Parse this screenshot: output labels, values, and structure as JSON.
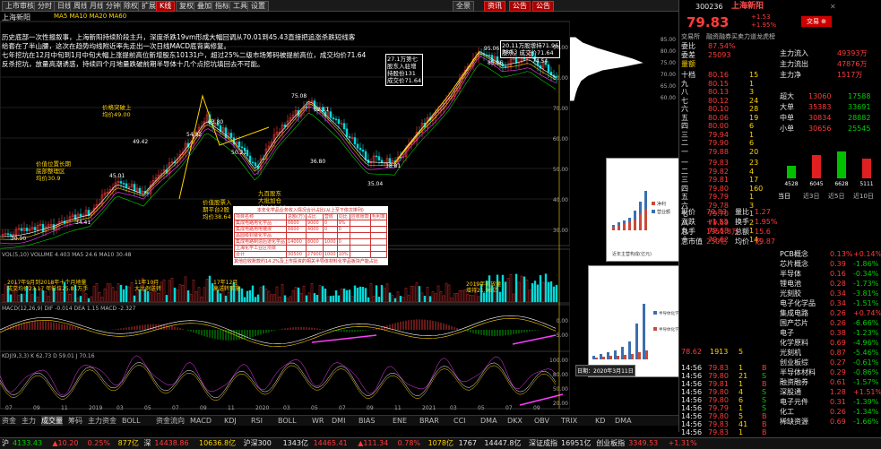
{
  "toolbar": {
    "buttons": [
      "上市审核",
      "分时",
      "日线",
      "周线",
      "月线",
      "分钟",
      "除权",
      "扩展",
      "K线",
      "复权",
      "叠加",
      "指标",
      "工具",
      "设置"
    ],
    "right_buttons": [
      "全景",
      "资讯",
      "公告",
      "公告"
    ]
  },
  "chart": {
    "title": "上海新阳",
    "indicator_bar": "MA5 MA10 MA20 MA60",
    "commentary": [
      "历史底部一次性报叙事，上海新阳持续阶段主升，深度杀跌19vm形成大幅回调从70.01到45.43直接把追涨杀跌短线客",
      "给套在了半山腰，这次在趋势均线附近率先走出一次日线MACD底背离修复。",
      "七年挖坑在12月中旬到1月中旬大幅上涨提前高位新增股东10131户，超过25%二级市场筹码被提前高位，成交均价71.64",
      "反杀挖坑，放量高潮诱惑，持续四个月地量跌破前期半导体十几个点挖坑填回去不可能。"
    ],
    "annotations": [
      {
        "text": "27.1万第七\n股东入驻增\n持股份131\n成交价71.64"
      },
      {
        "text": "20.11万股增持71.96\n股东，成交价71.64"
      },
      {
        "text": "价值位置长期\n底部整理区\n均价30.9"
      },
      {
        "text": "价格突破上\n均价49.00"
      },
      {
        "text": "价值股票入\n期平台2股\n均价38.64"
      },
      {
        "text": "九百股东\n大批加仓\n均价38.18"
      }
    ],
    "price_labels": [
      "95.06",
      "85.86",
      "78.53",
      "74.54",
      "75.08",
      "63.80",
      "62.11",
      "54.92",
      "50.21",
      "49.42",
      "45.01",
      "38.81",
      "36.80",
      "35.04",
      "34.41",
      "30.90"
    ],
    "y_ticks": [
      "90.00",
      "80.00",
      "70.00",
      "60.00",
      "50.00",
      "40.00",
      "30.00"
    ],
    "table_title": "本年化学品业务收入情况合计占比(从上至下依次排列)",
    "table_headers": [
      "项目名称",
      "总额(万)",
      "占比",
      "营收",
      "同比",
      "应收账款",
      "毛利率"
    ],
    "table_rows": [
      [
        "集成电路用化学品",
        "6600",
        "9000",
        "0",
        "9%",
        "",
        ""
      ],
      [
        "集成电路用电镀液",
        "6600",
        "4000",
        "0",
        "0",
        "",
        ""
      ],
      [
        "晶圆级封装化学品",
        "",
        "",
        "",
        "",
        "",
        ""
      ],
      [
        "集成电路制造后道化学品",
        "14000",
        "8000",
        "1000",
        "0",
        "",
        ""
      ],
      [
        "上海化学工业区项目",
        "",
        "",
        "",
        "",
        "",
        ""
      ],
      [
        "合计",
        "30500",
        "27900",
        "1000",
        "10%",
        "",
        ""
      ]
    ],
    "table_footer": "其他应收账款约14.2%及上市投资的相关半导体材料化学品板块产能占比",
    "volume_label": "VOL(5,10) VOLUME 4.403 MA5 24.6 MA10 30.48",
    "volume_notes": [
      {
        "text": "2017年9月到2018年十个月地量\n成交均价23.17 年低位25.81万手"
      },
      {
        "text": "11年10月\n大比例送转"
      },
      {
        "text": "17年12月\n高送转实施"
      },
      {
        "text": "2019年初放量\n增持21.96亿"
      }
    ],
    "macd_label": "MACD(12,26,9) DIF -0.014 DEA 1.15 MACD -2.327",
    "macd_ticks": [
      "0.00",
      "-5.00"
    ],
    "kdj_label": "KDJ(9,3,3) K 62.73 D 59.01 J 70.16",
    "kdj_ticks": [
      "100.00",
      "80.00",
      "50.00",
      "20.00"
    ],
    "x_ticks": [
      "07",
      "09",
      "11",
      "2019",
      "03",
      "05",
      "07",
      "09",
      "11",
      "2020",
      "03",
      "05",
      "07",
      "09",
      "11",
      "2021",
      "03",
      "05",
      "07",
      "09"
    ]
  },
  "strip": {
    "axis": [
      "85.00",
      "80.00",
      "75.00",
      "70.00",
      "65.00",
      "60.00"
    ],
    "mini_chart1": {
      "legend": [
        "净利",
        "营业额"
      ],
      "caption": "近年主营构成(亿元)"
    },
    "mini_chart2": {
      "legend": [
        "半导体化学品营业收入(亿元)",
        "半导体化学品产出(万吨)"
      ]
    },
    "tooltip": "日期：2020年3月11日"
  },
  "quote": {
    "code": "300236",
    "name": "上海新阳",
    "price": "79.83",
    "change": "+1.53",
    "pct": "+1.95%",
    "tabs": [
      "交易所",
      "融资融券",
      "买卖力道",
      "龙虎榜"
    ],
    "mini_stats": [
      [
        "委比",
        "87.54%"
      ],
      [
        "委差",
        "25093"
      ]
    ],
    "level_tag": "量额",
    "sells": [
      [
        "十档",
        "80.16",
        "15"
      ],
      [
        "九",
        "80.15",
        "1"
      ],
      [
        "八",
        "80.13",
        "3"
      ],
      [
        "七",
        "80.12",
        "24"
      ],
      [
        "六",
        "80.10",
        "28"
      ],
      [
        "五",
        "80.06",
        "19"
      ],
      [
        "四",
        "80.00",
        "6"
      ],
      [
        "三",
        "79.94",
        "1"
      ],
      [
        "二",
        "79.90",
        "6"
      ],
      [
        "一",
        "79.88",
        "20"
      ]
    ],
    "buys": [
      [
        "一",
        "79.83",
        "23"
      ],
      [
        "二",
        "79.82",
        "4"
      ],
      [
        "三",
        "79.81",
        "17"
      ],
      [
        "四",
        "79.80",
        "160"
      ],
      [
        "五",
        "79.79",
        "1"
      ],
      [
        "六",
        "79.78",
        "3"
      ],
      [
        "七",
        "79.70",
        "1"
      ],
      [
        "八",
        "79.69",
        "2"
      ],
      [
        "九",
        "79.68",
        "1"
      ],
      [
        "十",
        "79.62",
        "14"
      ]
    ],
    "flows": [
      [
        "主力流入",
        "49393万"
      ],
      [
        "主力流出",
        "47876万"
      ],
      [
        "主力净",
        "1517万"
      ]
    ],
    "big_orders": [
      [
        "超大",
        "13060",
        "17588"
      ],
      [
        "大单",
        "35383",
        "33691"
      ],
      [
        "中单",
        "30834",
        "28882"
      ],
      [
        "小单",
        "30656",
        "25545"
      ]
    ],
    "bar_values": [
      "4528",
      "6045",
      "6628",
      "5111"
    ],
    "order_tabs": [
      "当日",
      "近3日",
      "近5日",
      "近10日"
    ],
    "details": [
      [
        "现价",
        "79.83",
        "量比",
        "1.27"
      ],
      [
        "涨跌",
        "+1.53",
        "换手",
        "1.95%"
      ],
      [
        "总手",
        "1951.8万",
        "总额",
        "15.6亿"
      ],
      [
        "总市值",
        "250亿",
        "均价",
        "79.87"
      ]
    ],
    "sectors": [
      [
        "PCB概念",
        "0.13%",
        "+0.14%"
      ],
      [
        "芯片概念",
        "0.39",
        "-1.86%"
      ],
      [
        "半导体",
        "0.16",
        "-0.34%"
      ],
      [
        "锂电池",
        "0.28",
        "-1.73%"
      ],
      [
        "光刻胶",
        "0.34",
        "-3.81%"
      ],
      [
        "电子化学品",
        "0.34",
        "-1.51%"
      ],
      [
        "集成电路",
        "0.26",
        "+0.74%"
      ],
      [
        "国产芯片",
        "0.26",
        "-6.66%"
      ],
      [
        "电子",
        "0.38",
        "-1.23%"
      ],
      [
        "化学原料",
        "0.69",
        "-4.96%"
      ],
      [
        "光刻机",
        "0.87",
        "-5.46%"
      ],
      [
        "创业板综",
        "0.27",
        "-0.61%"
      ],
      [
        "半导体材料",
        "0.29",
        "-0.86%"
      ],
      [
        "融资融券",
        "0.61",
        "-1.57%"
      ],
      [
        "深股通",
        "1.28",
        "+1.51%"
      ],
      [
        "电子元件",
        "0.31",
        "-1.39%"
      ],
      [
        "化工",
        "0.26",
        "-1.34%"
      ],
      [
        "稀缺资源",
        "0.69",
        "-1.66%"
      ]
    ],
    "ticks": [
      [
        "14:56",
        "79.83",
        "1",
        "B"
      ],
      [
        "14:56",
        "79.80",
        "21",
        "S"
      ],
      [
        "14:56",
        "79.81",
        "1",
        "B"
      ],
      [
        "14:56",
        "79.80",
        "4",
        "S"
      ],
      [
        "14:56",
        "79.80",
        "6",
        "S"
      ],
      [
        "14:56",
        "79.79",
        "1",
        "S"
      ],
      [
        "14:56",
        "79.80",
        "5",
        "B"
      ],
      [
        "14:56",
        "79.83",
        "41",
        "B"
      ],
      [
        "14:56",
        "79.83",
        "1",
        "B"
      ]
    ],
    "summary": [
      [
        "78.62",
        "1913",
        "5"
      ]
    ]
  },
  "ind_tabs": [
    "资金",
    "主力",
    "成交量",
    "筹码",
    "主力资金",
    "BOLL",
    "资金流向",
    "MACD",
    "KDJ",
    "RSI",
    "BOLL",
    "WR",
    "DMI",
    "BIAS",
    "ENE",
    "BRAR",
    "CCI",
    "DMA",
    "DKX",
    "OBV",
    "TRIX",
    "KD",
    "DMA",
    "TRIX",
    "DPO",
    "扩展",
    "指标",
    "多空",
    "操盘",
    "更多"
  ],
  "status": [
    {
      "label": "沪",
      "value": "4133.43",
      "cls": "green"
    },
    {
      "label": "",
      "value": "▲10.20",
      "cls": "red"
    },
    {
      "label": "",
      "value": "0.25%",
      "cls": "red"
    },
    {
      "label": "",
      "value": "877亿",
      "cls": "yel"
    },
    {
      "label": "深",
      "value": "14438.86",
      "cls": "red"
    },
    {
      "label": "",
      "value": "10636.8亿",
      "cls": "yel"
    },
    {
      "label": "沪深300",
      "value": "1343亿",
      "cls": "white"
    },
    {
      "label": "",
      "value": "14465.41",
      "cls": "red"
    },
    {
      "label": "",
      "value": "▲111.34",
      "cls": "red"
    },
    {
      "label": "",
      "value": "0.78%",
      "cls": "red"
    },
    {
      "label": "",
      "value": "1078亿",
      "cls": "yel"
    },
    {
      "label": "",
      "value": "1767",
      "cls": "white"
    },
    {
      "label": "",
      "value": "14447.8亿",
      "cls": "white"
    },
    {
      "label": "深证成指",
      "value": "16951亿",
      "cls": "white"
    },
    {
      "label": "创业板指",
      "value": "3349.53",
      "cls": "red"
    },
    {
      "label": "",
      "value": "+1.31%",
      "cls": "red"
    }
  ]
}
